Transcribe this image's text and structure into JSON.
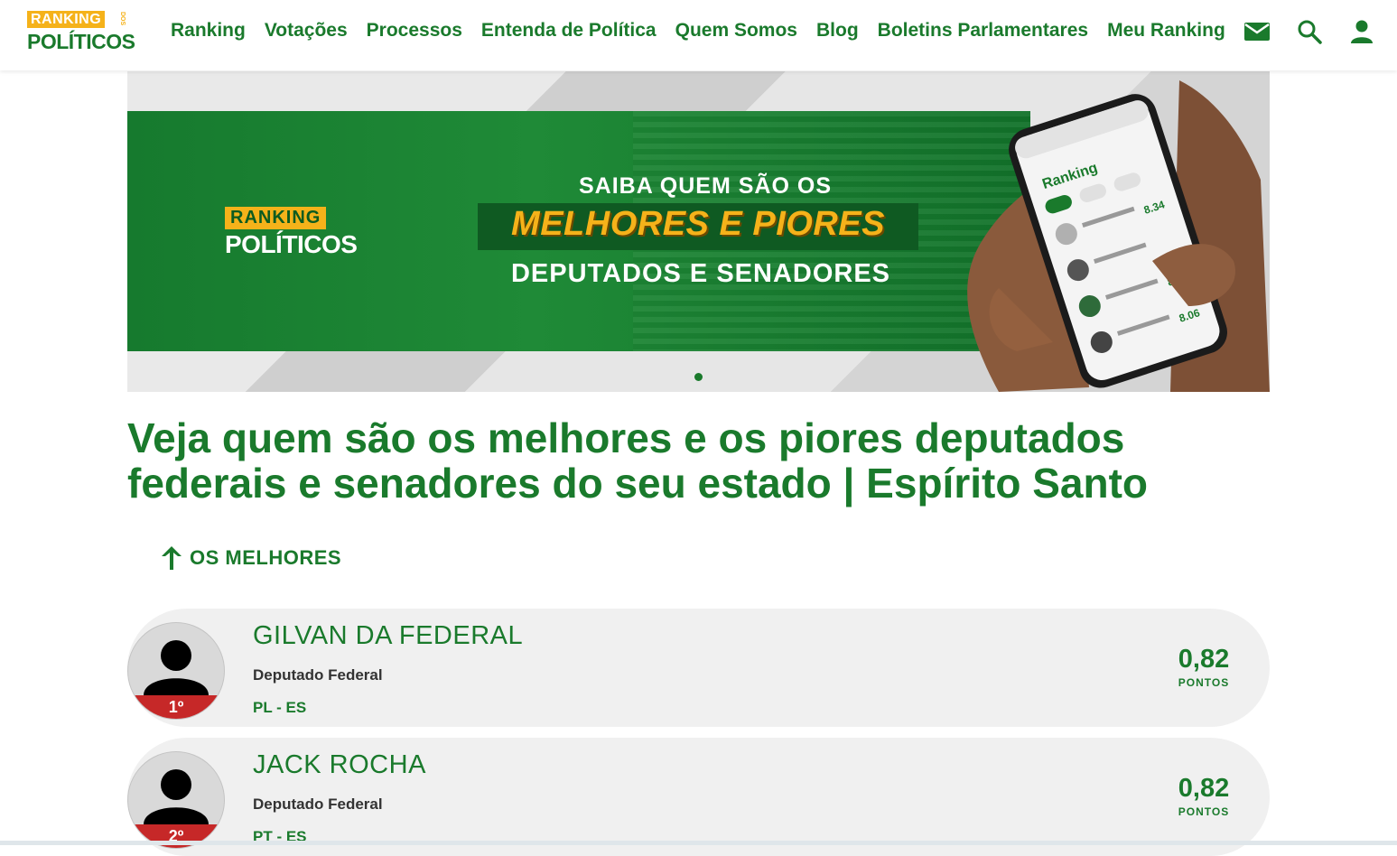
{
  "header": {
    "logo_top": "RANKING",
    "logo_dos": "DOS",
    "logo_bottom": "POLÍTICOS",
    "nav": [
      "Ranking",
      "Votações",
      "Processos",
      "Entenda de Política",
      "Quem Somos",
      "Blog",
      "Boletins Parlamentares",
      "Meu Ranking"
    ],
    "icons": [
      "mail-icon",
      "search-icon",
      "user-icon"
    ]
  },
  "banner": {
    "logo_top": "RANKING",
    "logo_bottom": "POLÍTICOS",
    "line1": "SAIBA QUEM SÃO OS",
    "line2": "MELHORES E PIORES",
    "line3": "DEPUTADOS E SENADORES",
    "phone_heading": "Ranking"
  },
  "page": {
    "title": "Veja quem são os melhores e os piores deputados federais e senadores do seu estado | Espírito Santo",
    "section_label": "OS MELHORES"
  },
  "politicians": [
    {
      "rank": "1º",
      "name": "GILVAN DA FEDERAL",
      "role": "Deputado Federal",
      "party": "PL - ES",
      "score": "0,82",
      "score_unit": "PONTOS"
    },
    {
      "rank": "2º",
      "name": "JACK ROCHA",
      "role": "Deputado Federal",
      "party": "PT - ES",
      "score": "0,82",
      "score_unit": "PONTOS"
    }
  ],
  "colors": {
    "brand_green": "#1a7a2c",
    "brand_yellow": "#f5b21a",
    "rank_red": "#c62828"
  }
}
